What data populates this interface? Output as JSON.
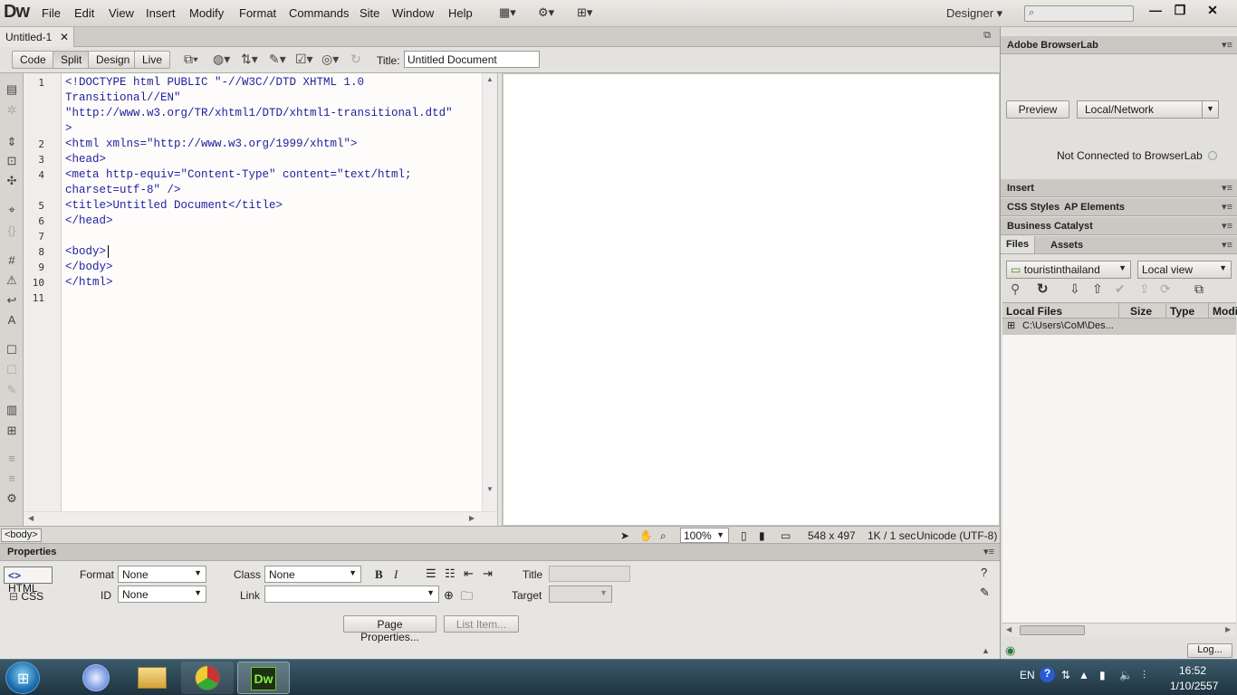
{
  "app": {
    "logo": "Dw",
    "workspace": "Designer ▾"
  },
  "menu": [
    "File",
    "Edit",
    "View",
    "Insert",
    "Modify",
    "Format",
    "Commands",
    "Site",
    "Window",
    "Help"
  ],
  "doc_tab": {
    "name": "Untitled-1",
    "close": "✕"
  },
  "views": {
    "code": "Code",
    "split": "Split",
    "design": "Design",
    "live": "Live"
  },
  "title_label": "Title:",
  "title_value": "Untitled Document",
  "line_numbers": [
    "1",
    "",
    "",
    "",
    "2",
    "3",
    "4",
    "",
    "5",
    "6",
    "7",
    "8",
    "9",
    "10",
    "11"
  ],
  "code_lines": [
    "<!DOCTYPE html PUBLIC \"-//W3C//DTD XHTML 1.0",
    "Transitional//EN\"",
    "\"http://www.w3.org/TR/xhtml1/DTD/xhtml1-transitional.dtd\"",
    ">",
    "<html xmlns=\"http://www.w3.org/1999/xhtml\">",
    "<head>",
    "<meta http-equiv=\"Content-Type\" content=\"text/html;",
    "charset=utf-8\" />",
    "<title>Untitled Document</title>",
    "</head>",
    "",
    "<body>",
    "</body>",
    "</html>",
    ""
  ],
  "status": {
    "tag": "<body>",
    "zoom": "100%",
    "size": "548 x 497",
    "download": "1K / 1 sec",
    "encoding": "Unicode (UTF-8)"
  },
  "properties": {
    "header": "Properties",
    "html_btn": "HTML",
    "css_btn": "CSS",
    "format_label": "Format",
    "format_value": "None",
    "class_label": "Class",
    "class_value": "None",
    "id_label": "ID",
    "id_value": "None",
    "link_label": "Link",
    "title_label": "Title",
    "target_label": "Target",
    "page_props": "Page Properties...",
    "list_item": "List Item...",
    "bold": "B",
    "italic": "I"
  },
  "right_panel": {
    "browserlab": "Adobe BrowserLab",
    "preview": "Preview",
    "local_network": "Local/Network",
    "not_connected": "Not Connected to BrowserLab",
    "insert": "Insert",
    "css_styles": "CSS Styles",
    "ap_elements": "AP Elements",
    "business_catalyst": "Business Catalyst",
    "files": "Files",
    "assets": "Assets",
    "site": "touristinthailand",
    "view": "Local view",
    "col_local": "Local Files",
    "col_size": "Size",
    "col_type": "Type",
    "col_mod": "Modi",
    "tree_item": "C:\\Users\\CoM\\Des...",
    "log": "Log..."
  },
  "taskbar": {
    "lang": "EN",
    "time": "16:52",
    "date": "1/10/2557"
  }
}
